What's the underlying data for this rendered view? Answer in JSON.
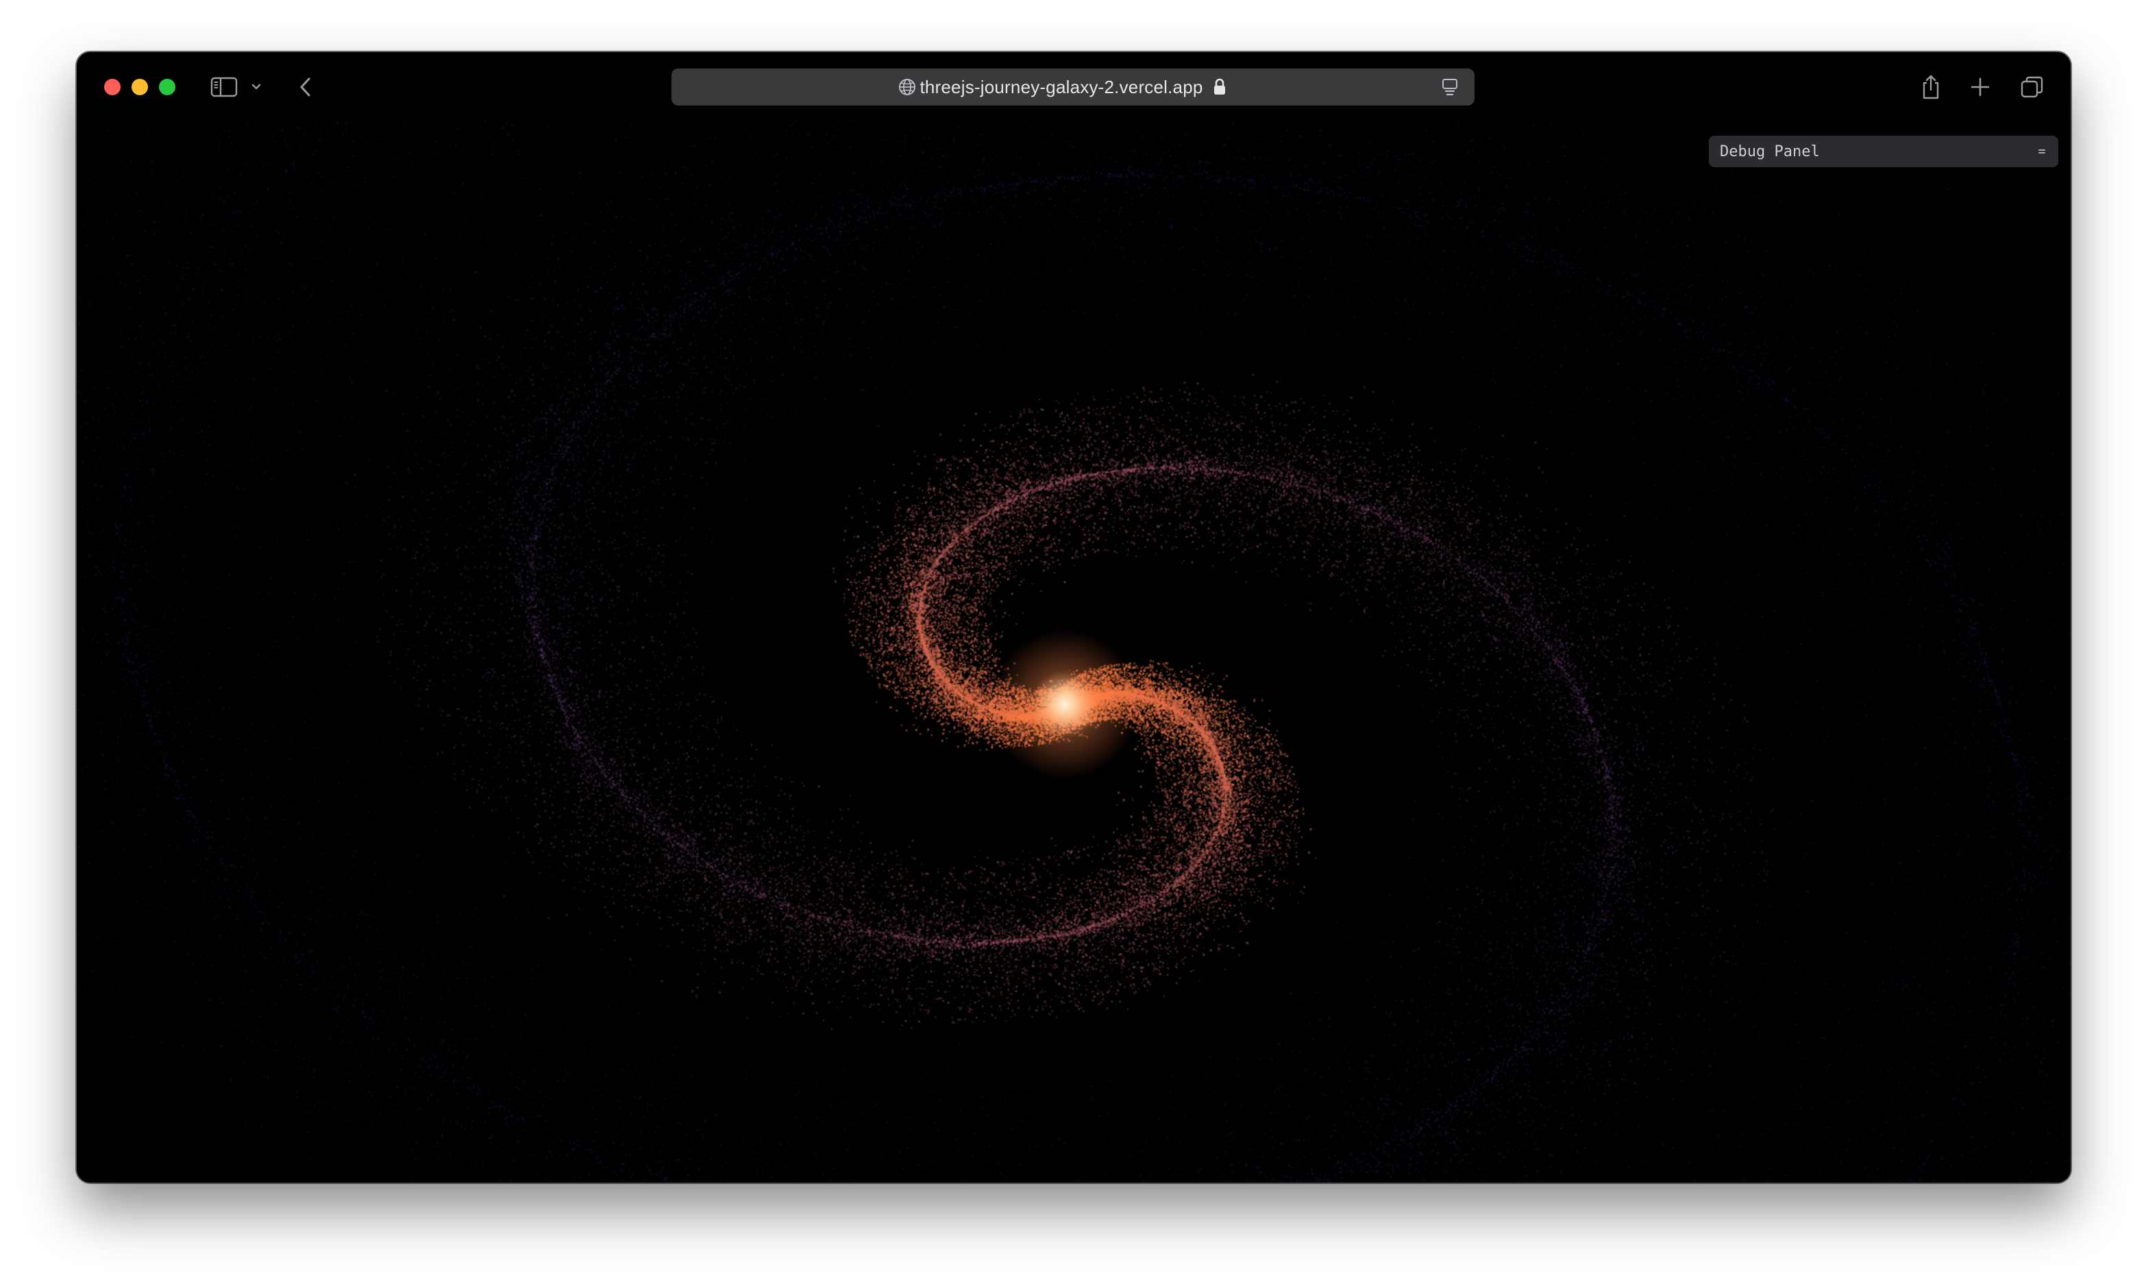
{
  "browser": {
    "url": "threejs-journey-galaxy-2.vercel.app",
    "icons": {
      "close": "close-traffic-light",
      "minimize": "minimize-traffic-light",
      "maximize": "maximize-traffic-light",
      "sidebar": "sidebar-icon",
      "chevron": "chevron-down-icon",
      "back": "chevron-left-icon",
      "globe": "globe-icon",
      "lock": "lock-icon",
      "reader": "reader-icon",
      "share": "share-icon",
      "new_tab": "plus-icon",
      "tabs": "tab-overview-icon"
    },
    "colors": {
      "close": "#ff5f57",
      "minimize": "#febc2e",
      "maximize": "#28c840",
      "urlbar": "#3a3a3c"
    }
  },
  "debug_panel": {
    "title": "Debug Panel",
    "toggle_icon": "collapse-toggle-icon"
  },
  "scene": {
    "description_icon": "galaxy-particles",
    "inside_color": "#ff7a3d",
    "outside_color": "#3a2a8f",
    "background": "#000000"
  }
}
